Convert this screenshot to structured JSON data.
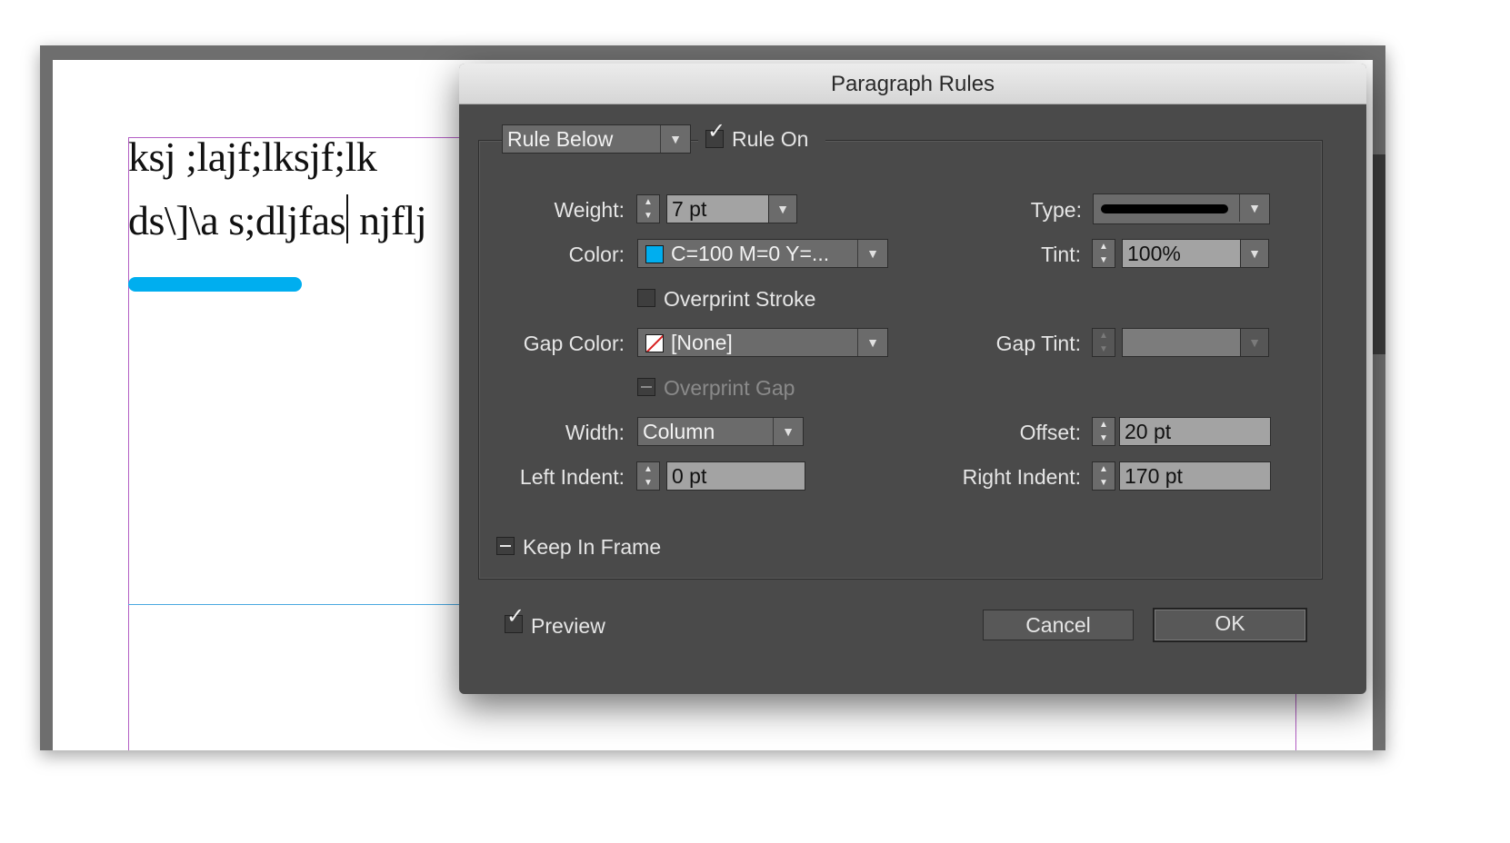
{
  "document": {
    "text_line_1": "ksj ;lajf;lksjf;lk",
    "text_line_2_before_cursor": "ds\\]\\a s;dljfas",
    "text_line_2_after_cursor": " njflj",
    "rule_color": "#00aeef"
  },
  "dialog": {
    "title": "Paragraph Rules",
    "rule_select": "Rule Below",
    "rule_on_label": "Rule On",
    "rule_on_checked": true,
    "weight": {
      "label": "Weight:",
      "value": "7 pt"
    },
    "type": {
      "label": "Type:",
      "value": "solid-line"
    },
    "color": {
      "label": "Color:",
      "value": "C=100 M=0 Y=...",
      "swatch": "#00aeef"
    },
    "tint": {
      "label": "Tint:",
      "value": "100%"
    },
    "overprint_stroke": {
      "label": "Overprint Stroke",
      "checked": false
    },
    "gap_color": {
      "label": "Gap Color:",
      "value": "[None]"
    },
    "gap_tint": {
      "label": "Gap Tint:",
      "value": ""
    },
    "overprint_gap": {
      "label": "Overprint Gap",
      "disabled": true
    },
    "width": {
      "label": "Width:",
      "value": "Column"
    },
    "offset": {
      "label": "Offset:",
      "value": "20 pt"
    },
    "left_indent": {
      "label": "Left Indent:",
      "value": "0 pt"
    },
    "right_indent": {
      "label": "Right Indent:",
      "value": "170 pt"
    },
    "keep_in_frame": {
      "label": "Keep In Frame",
      "state": "mixed"
    },
    "preview": {
      "label": "Preview",
      "checked": true
    },
    "cancel_label": "Cancel",
    "ok_label": "OK",
    "up_glyph": "▲",
    "down_glyph": "▼",
    "arrow_glyph": "▼",
    "check_glyph": "✓"
  }
}
